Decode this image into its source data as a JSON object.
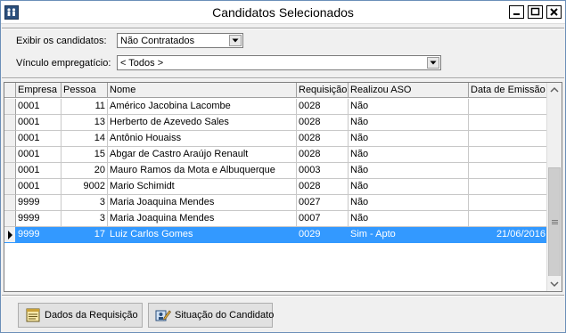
{
  "window": {
    "title": "Candidatos Selecionados"
  },
  "filters": {
    "exibir_label": "Exibir os candidatos:",
    "exibir_value": "Não Contratados",
    "vinculo_label": "Vínculo empregatício:",
    "vinculo_value": "< Todos >"
  },
  "grid": {
    "columns": [
      "Empresa",
      "Pessoa",
      "Nome",
      "Requisição",
      "Realizou ASO",
      "Data de Emissão"
    ],
    "rows": [
      {
        "empresa": "0001",
        "pessoa": "11",
        "nome": "Américo Jacobina Lacombe",
        "requisicao": "0028",
        "aso": "Não",
        "data": ""
      },
      {
        "empresa": "0001",
        "pessoa": "13",
        "nome": "Herberto de Azevedo Sales",
        "requisicao": "0028",
        "aso": "Não",
        "data": ""
      },
      {
        "empresa": "0001",
        "pessoa": "14",
        "nome": "Antônio Houaiss",
        "requisicao": "0028",
        "aso": "Não",
        "data": ""
      },
      {
        "empresa": "0001",
        "pessoa": "15",
        "nome": "Abgar de Castro  Araújo Renault",
        "requisicao": "0028",
        "aso": "Não",
        "data": ""
      },
      {
        "empresa": "0001",
        "pessoa": "20",
        "nome": "Mauro Ramos da Mota e Albuquerque",
        "requisicao": "0003",
        "aso": "Não",
        "data": ""
      },
      {
        "empresa": "0001",
        "pessoa": "9002",
        "nome": "Mario Schimidt",
        "requisicao": "0028",
        "aso": "Não",
        "data": ""
      },
      {
        "empresa": "9999",
        "pessoa": "3",
        "nome": "Maria Joaquina Mendes",
        "requisicao": "0027",
        "aso": "Não",
        "data": ""
      },
      {
        "empresa": "9999",
        "pessoa": "3",
        "nome": "Maria Joaquina Mendes",
        "requisicao": "0007",
        "aso": "Não",
        "data": ""
      },
      {
        "empresa": "9999",
        "pessoa": "17",
        "nome": "Luiz Carlos Gomes",
        "requisicao": "0029",
        "aso": "Sim - Apto",
        "data": "21/06/2016",
        "selected": true
      }
    ]
  },
  "buttons": {
    "dados": "Dados da Requisição",
    "situacao": "Situação do Candidato"
  }
}
